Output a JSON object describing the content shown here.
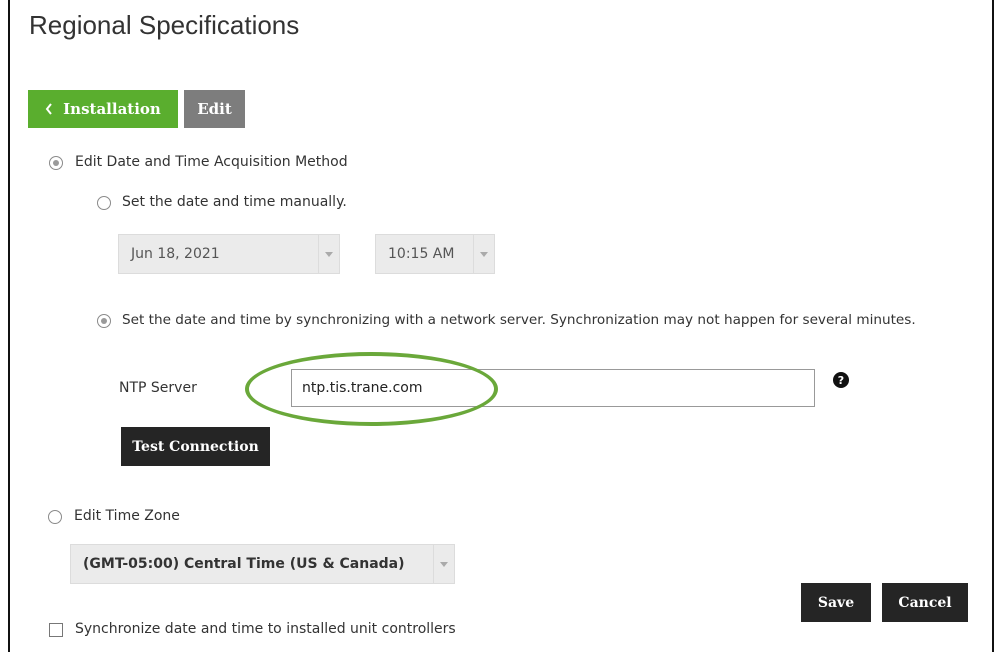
{
  "page": {
    "title": "Regional Specifications"
  },
  "nav": {
    "back_label": "Installation",
    "back_icon": "chevron-left-icon",
    "edit_label": "Edit"
  },
  "acquisition": {
    "label": "Edit Date and Time Acquisition Method",
    "manual": {
      "label": "Set the date and time manually.",
      "date_value": "Jun 18, 2021",
      "time_value": "10:15 AM"
    },
    "network": {
      "label": "Set the date and time by synchronizing with a network server. Synchronization may not happen for several minutes.",
      "ntp_label": "NTP Server",
      "ntp_value": "ntp.tis.trane.com",
      "help_symbol": "?",
      "test_button": "Test Connection"
    }
  },
  "timezone": {
    "label": "Edit Time Zone",
    "selected": "(GMT-05:00) Central Time (US & Canada)"
  },
  "sync": {
    "label": "Synchronize date and time to installed unit controllers",
    "checked": false
  },
  "actions": {
    "save": "Save",
    "cancel": "Cancel"
  },
  "colors": {
    "install_button": "#5aae2e",
    "edit_button": "#7d7d7d",
    "dark_button": "#252525",
    "highlight": "#6aa83a"
  }
}
